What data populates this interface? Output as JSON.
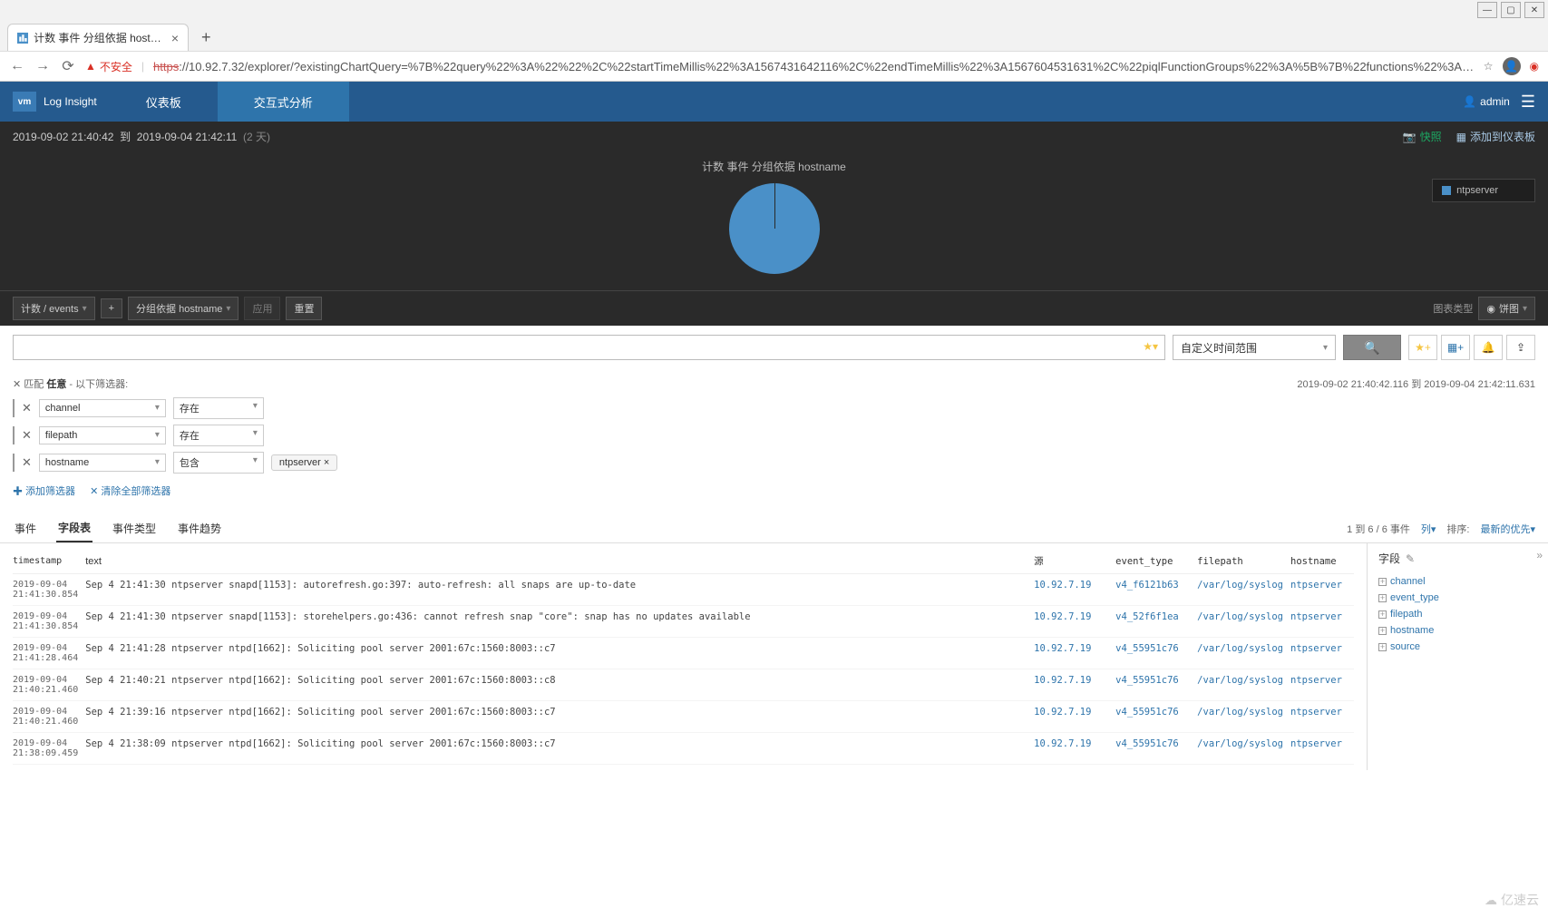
{
  "browser": {
    "tab_title": "计数 事件 分组依据 hostname ×",
    "security_label": "不安全",
    "url_scheme": "https",
    "url_rest": "://10.92.7.32/explorer/?existingChartQuery=%7B%22query%22%3A%22%22%2C%22startTimeMillis%22%3A1567431642116%2C%22endTimeMillis%22%3A1567604531631%2C%22piqlFunctionGroups%22%3A%5B%7B%22functions%22%3A%5B%7B%22label%22%3A…"
  },
  "header": {
    "brand": "Log Insight",
    "logo": "vm",
    "nav": {
      "dashboard": "仪表板",
      "interactive": "交互式分析"
    },
    "user": "admin"
  },
  "timebar": {
    "start": "2019-09-02  21:40:42",
    "to": "到",
    "end": "2019-09-04  21:42:11",
    "span": "(2 天)",
    "snapshot": "快照",
    "add_to_dash": "添加到仪表板"
  },
  "chart_data": {
    "type": "pie",
    "title": "计数 事件 分组依据 hostname",
    "categories": [
      "ntpserver"
    ],
    "values": [
      6
    ],
    "legend_position": "right"
  },
  "query": {
    "count_events": "计数 / events",
    "group_by": "分组依据 hostname",
    "apply": "应用",
    "reset": "重置",
    "chart_type_label": "图表类型",
    "chart_type_value": "饼图"
  },
  "search": {
    "placeholder": "",
    "time_range": "自定义时间范围",
    "detail_range": "2019-09-02  21:40:42.116  到  2019-09-04  21:42:11.631"
  },
  "filters": {
    "match_prefix": "匹配",
    "match_any": "任意",
    "match_suffix": "- 以下筛选器:",
    "rows": [
      {
        "field": "channel",
        "op": "存在",
        "value": ""
      },
      {
        "field": "filepath",
        "op": "存在",
        "value": ""
      },
      {
        "field": "hostname",
        "op": "包含",
        "value": "ntpserver"
      }
    ],
    "add": "添加筛选器",
    "clear": "清除全部筛选器"
  },
  "tabs": {
    "events": "事件",
    "fieldtable": "字段表",
    "eventtypes": "事件类型",
    "eventtrends": "事件趋势",
    "summary": "1 到 6 / 6 事件",
    "columns": "列",
    "sort_label": "排序:",
    "sort_value": "最新的优先"
  },
  "columns": {
    "timestamp": "timestamp",
    "text": "text",
    "source": "源",
    "event_type": "event_type",
    "filepath": "filepath",
    "hostname": "hostname"
  },
  "rows": [
    {
      "ts": "2019-09-04 21:41:30.854",
      "text": "Sep 4 21:41:30 ntpserver snapd[1153]: autorefresh.go:397: auto-refresh: all snaps are up-to-date",
      "src": "10.92.7.19",
      "et": "v4_f6121b63",
      "fp": "/var/log/syslog",
      "hn": "ntpserver"
    },
    {
      "ts": "2019-09-04 21:41:30.854",
      "text": "Sep 4 21:41:30 ntpserver snapd[1153]: storehelpers.go:436: cannot refresh snap \"core\": snap has no updates available",
      "src": "10.92.7.19",
      "et": "v4_52f6f1ea",
      "fp": "/var/log/syslog",
      "hn": "ntpserver"
    },
    {
      "ts": "2019-09-04 21:41:28.464",
      "text": "Sep 4 21:41:28 ntpserver ntpd[1662]: Soliciting pool server 2001:67c:1560:8003::c7",
      "src": "10.92.7.19",
      "et": "v4_55951c76",
      "fp": "/var/log/syslog",
      "hn": "ntpserver"
    },
    {
      "ts": "2019-09-04 21:40:21.460",
      "text": "Sep 4 21:40:21 ntpserver ntpd[1662]: Soliciting pool server 2001:67c:1560:8003::c8",
      "src": "10.92.7.19",
      "et": "v4_55951c76",
      "fp": "/var/log/syslog",
      "hn": "ntpserver"
    },
    {
      "ts": "2019-09-04 21:40:21.460",
      "text": "Sep 4 21:39:16 ntpserver ntpd[1662]: Soliciting pool server 2001:67c:1560:8003::c7",
      "src": "10.92.7.19",
      "et": "v4_55951c76",
      "fp": "/var/log/syslog",
      "hn": "ntpserver"
    },
    {
      "ts": "2019-09-04 21:38:09.459",
      "text": "Sep 4 21:38:09 ntpserver ntpd[1662]: Soliciting pool server 2001:67c:1560:8003::c7",
      "src": "10.92.7.19",
      "et": "v4_55951c76",
      "fp": "/var/log/syslog",
      "hn": "ntpserver"
    }
  ],
  "fields_panel": {
    "title": "字段",
    "items": [
      "channel",
      "event_type",
      "filepath",
      "hostname",
      "source"
    ]
  },
  "watermark": "亿速云"
}
